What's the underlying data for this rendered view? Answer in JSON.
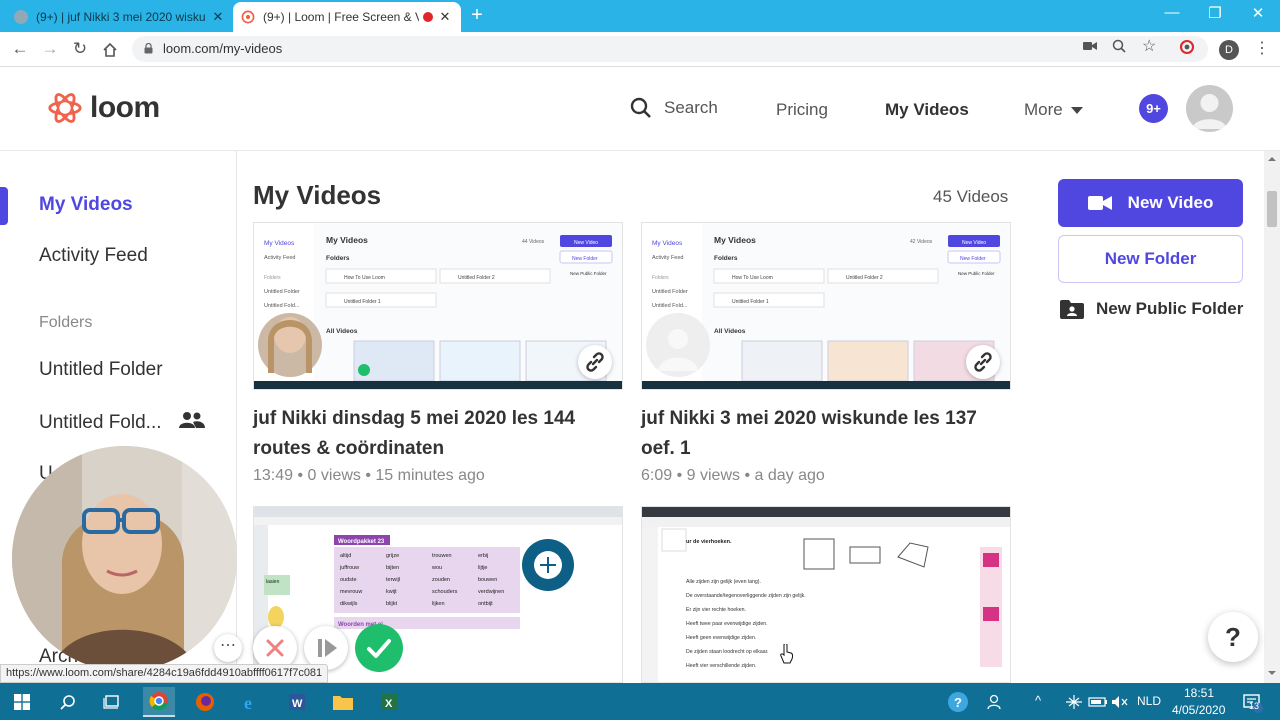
{
  "browser": {
    "tabs": [
      {
        "title": "(9+) | juf Nikki 3 mei 2020 wiskun",
        "close": "✕"
      },
      {
        "title": "(9+) | Loom | Free Screen & V",
        "close": "✕"
      }
    ],
    "new_tab": "+",
    "window_controls": {
      "minimize": "—",
      "maximize": "❐",
      "close": "✕"
    },
    "url": "loom.com/my-videos",
    "profile_initial": "D"
  },
  "header": {
    "logo_text": "loom",
    "search_label": "Search",
    "nav": [
      {
        "label": "Pricing"
      },
      {
        "label": "My Videos"
      },
      {
        "label": "More"
      }
    ],
    "notification_badge": "9+",
    "accent_color": "#5047e0",
    "logo_color": "#f0624a"
  },
  "sidebar": {
    "items": [
      {
        "label": "My Videos"
      },
      {
        "label": "Activity Feed"
      }
    ],
    "folders_heading": "Folders",
    "folders": [
      {
        "label": "Untitled Folder"
      },
      {
        "label": "Untitled Fold..."
      },
      {
        "label": "U"
      },
      {
        "label": "Arch"
      }
    ]
  },
  "main": {
    "title": "My Videos",
    "count": "45 Videos",
    "videos": [
      {
        "title_line1": "juf Nikki dinsdag 5 mei 2020 les 144",
        "title_line2": "routes & coördinaten",
        "duration": "13:49",
        "views": "0 views",
        "age": "15 minutes ago",
        "thumb": {
          "heading": "My Videos",
          "count": "44 Videos",
          "button": "New Video",
          "folder_btn": "New Folder",
          "pub_btn": "New Public Folder",
          "folders": "Folders",
          "f1": "How To Use Loom",
          "f2": "Untitled Folder 2",
          "f3": "Untitled Folder 1",
          "all": "All Videos",
          "s1": "My Videos",
          "s2": "Activity Feed",
          "s3": "Folders",
          "s4": "Untitled Folder",
          "s5": "Untitled Fold..."
        }
      },
      {
        "title_line1": "juf Nikki 3 mei 2020 wiskunde les 137",
        "title_line2": "oef. 1",
        "duration": "6:09",
        "views": "9 views",
        "age": "a day ago",
        "thumb": {
          "heading": "My Videos",
          "count": "42 Videos",
          "button": "New Video",
          "folder_btn": "New Folder",
          "pub_btn": "New Public Folder",
          "folders": "Folders",
          "f1": "How To Use Loom",
          "f2": "Untitled Folder 2",
          "f3": "Untitled Folder 1",
          "all": "All Videos",
          "s1": "My Videos",
          "s2": "Activity Feed",
          "s3": "Folders",
          "s4": "Untitled Folder",
          "s5": "Untitled Fold..."
        }
      },
      {
        "thumb": {
          "banner": "Woordpakket 23",
          "words": [
            "altijd",
            "grijze",
            "trouwen",
            "erbij",
            "juffrouw",
            "bijten",
            "wou",
            "lijtje",
            "oudste",
            "terwijl",
            "zouden",
            "bouwen",
            "mevrouw",
            "kwijt",
            "schouders",
            "verdwijnen",
            "dikwijls",
            "blijkt",
            "lijken",
            "ontbijt"
          ],
          "section": "Woorden met ei",
          "side_label": "laaien"
        }
      },
      {
        "thumb": {
          "heading": "ur de vierhoeken.",
          "rules": [
            "Alle zijden zijn gelijk (even lang).",
            "De overstaande/tegenoverliggende zijden zijn gelijk.",
            "Er zijn vier rechte hoeken.",
            "Heeft twee paar evenwijdige zijden.",
            "Heeft geen evenwijdige zijden.",
            "De zijden staan loodrecht op elkaar.",
            "Heeft vier verschillende zijden."
          ]
        }
      }
    ]
  },
  "actions": {
    "new_video": "New Video",
    "new_folder": "New Folder",
    "new_public_folder": "New Public Folder"
  },
  "help_label": "?",
  "recorder": {
    "more": "⋯"
  },
  "status_url": "https://www.loom.com/share/4284c19a6fdd4910abffff0617f7c081",
  "taskbar": {
    "language": "NLD",
    "time": "18:51",
    "date": "4/05/2020",
    "notification_count": "13"
  }
}
